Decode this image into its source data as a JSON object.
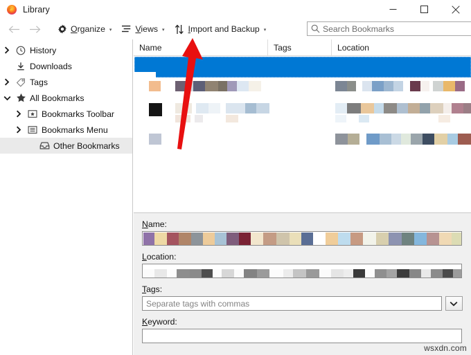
{
  "window": {
    "title": "Library",
    "app_icon": "firefox-logo-icon",
    "controls": {
      "minimize": "minimize-icon",
      "maximize": "maximize-icon",
      "close": "close-icon"
    }
  },
  "toolbar": {
    "back": "back-arrow-icon",
    "forward": "forward-arrow-icon",
    "organize": {
      "label": "Organize",
      "accel": "O",
      "icon": "gear-icon",
      "caret": "▾"
    },
    "views": {
      "label": "Views",
      "accel": "V",
      "icon": "list-view-icon",
      "caret": "▾"
    },
    "import_backup": {
      "label": "Import and Backup",
      "accel": "I",
      "icon": "import-export-arrows-icon",
      "caret": "▾"
    }
  },
  "search": {
    "icon": "search-icon",
    "placeholder": "Search Bookmarks",
    "value": ""
  },
  "sidebar": {
    "items": [
      {
        "label": "History",
        "icon": "clock-icon",
        "twisty": "collapsed",
        "indent": 1,
        "selected": false
      },
      {
        "label": "Downloads",
        "icon": "download-icon",
        "twisty": "none",
        "indent": 1,
        "selected": false
      },
      {
        "label": "Tags",
        "icon": "tag-icon",
        "twisty": "collapsed",
        "indent": 1,
        "selected": false
      },
      {
        "label": "All Bookmarks",
        "icon": "star-icon",
        "twisty": "expanded",
        "indent": 1,
        "selected": false
      },
      {
        "label": "Bookmarks Toolbar",
        "icon": "toolbar-folder-icon",
        "twisty": "collapsed",
        "indent": 2,
        "selected": false
      },
      {
        "label": "Bookmarks Menu",
        "icon": "menu-folder-icon",
        "twisty": "collapsed",
        "indent": 2,
        "selected": false
      },
      {
        "label": "Other Bookmarks",
        "icon": "inbox-folder-icon",
        "twisty": "none",
        "indent": 3,
        "selected": true
      }
    ]
  },
  "list": {
    "columns": [
      {
        "key": "name",
        "label": "Name"
      },
      {
        "key": "tags",
        "label": "Tags"
      },
      {
        "key": "location",
        "label": "Location"
      }
    ],
    "rows_redacted": true,
    "selected_row_index": 0,
    "selection_color": "#0078d4"
  },
  "detail": {
    "name": {
      "label": "Name:",
      "accel": "N",
      "value": "",
      "redacted": true
    },
    "location": {
      "label": "Location:",
      "accel": "L",
      "value": "",
      "redacted": true
    },
    "tags": {
      "label": "Tags:",
      "accel": "T",
      "placeholder": "Separate tags with commas",
      "value": "",
      "dropdown_icon": "chevron-down-icon"
    },
    "keyword": {
      "label": "Keyword:",
      "accel": "K",
      "value": ""
    }
  },
  "annotation": {
    "arrow_color": "#e81010",
    "points_to": "Import and Backup"
  },
  "watermark": {
    "text": "wsxdn.com"
  }
}
